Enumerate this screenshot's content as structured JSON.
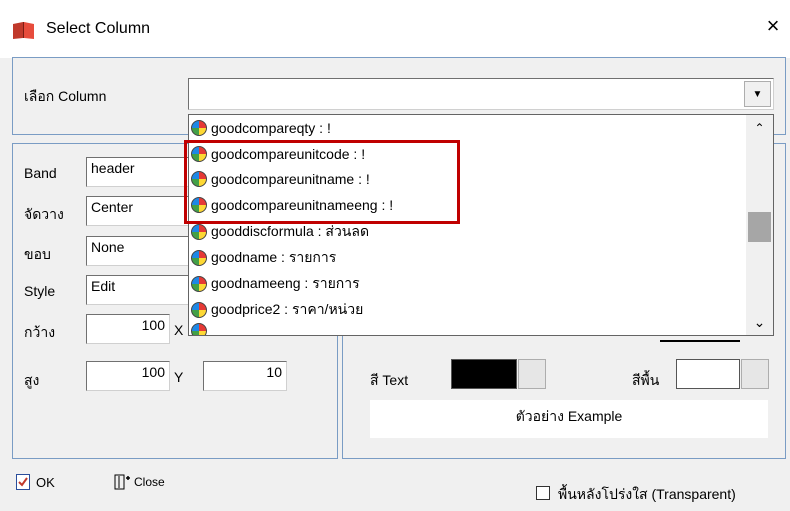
{
  "window": {
    "title": "Select Column",
    "close_glyph": "×"
  },
  "column_select": {
    "label": "เลือก Column",
    "value": ""
  },
  "dropdown_items": [
    "goodcompareqty : !",
    "goodcompareunitcode : !",
    "goodcompareunitname : !",
    "goodcompareunitnameeng : !",
    "gooddiscformula : ส่วนลด",
    "goodname : รายการ",
    "goodnameeng : รายการ",
    "goodprice2 : ราคา/หน่วย"
  ],
  "left_panel": {
    "band_label": "Band",
    "band_value": "header",
    "align_label": "จัดวาง",
    "align_value": "Center",
    "border_label": "ขอบ",
    "border_value": "None",
    "style_label": "Style",
    "style_value": "Edit",
    "width_label": "กว้าง",
    "width_value": "100",
    "x_label": "X",
    "height_label": "สูง",
    "height_value": "100",
    "y_label": "Y",
    "y_value": "10"
  },
  "right_panel": {
    "text_color_label": "สี Text",
    "text_color": "#000000",
    "bg_color_label": "สีพื้น",
    "bg_color": "#ffffff",
    "preview_text": "ตัวอย่าง Example"
  },
  "footer": {
    "ok_label": "OK",
    "close_label": "Close",
    "transparent_label": "พื้นหลังโปร่งใส (Transparent)"
  },
  "colors": {
    "highlight": "#c00000",
    "group_border": "#7a9cc4"
  },
  "icons": {
    "app": "book-icon",
    "ok": "ok-icon",
    "close": "exit-icon"
  }
}
